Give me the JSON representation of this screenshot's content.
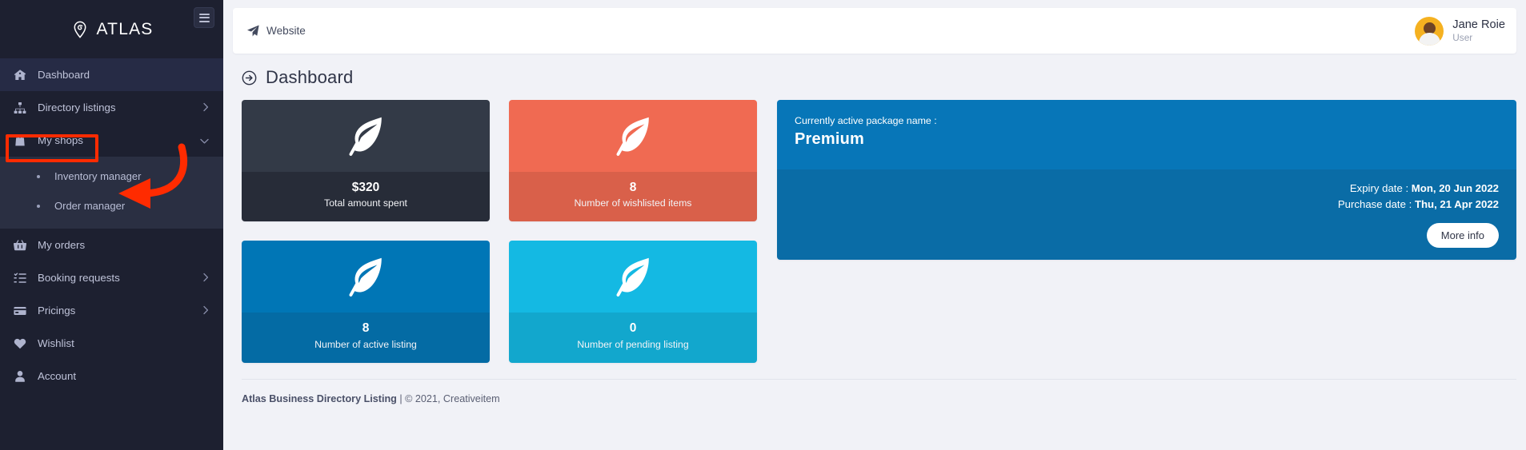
{
  "brand": {
    "name": "ATLAS",
    "icon": "location-pin-icon"
  },
  "sidebar": {
    "toggle_icon": "hamburger-icon",
    "items": [
      {
        "label": "Dashboard",
        "icon": "home-icon",
        "active": true,
        "chevron": ""
      },
      {
        "label": "Directory listings",
        "icon": "sitemap-icon",
        "active": false,
        "chevron": "›"
      },
      {
        "label": "My shops",
        "icon": "shop-bag-icon",
        "active": false,
        "chevron": "⌄"
      },
      {
        "label": "My orders",
        "icon": "basket-icon",
        "active": false,
        "chevron": ""
      },
      {
        "label": "Booking requests",
        "icon": "task-list-icon",
        "active": false,
        "chevron": "›"
      },
      {
        "label": "Pricings",
        "icon": "credit-card-icon",
        "active": false,
        "chevron": "›"
      },
      {
        "label": "Wishlist",
        "icon": "heart-icon",
        "active": false,
        "chevron": ""
      },
      {
        "label": "Account",
        "icon": "user-icon",
        "active": false,
        "chevron": ""
      }
    ],
    "submenu": [
      {
        "label": "Inventory manager"
      },
      {
        "label": "Order manager"
      }
    ]
  },
  "topbar": {
    "website_label": "Website",
    "website_icon": "paper-plane-icon",
    "user_name": "Jane Roie",
    "user_role": "User"
  },
  "page": {
    "title": "Dashboard",
    "title_icon": "arrow-circle-right-icon"
  },
  "stats": [
    {
      "value": "$320",
      "label": "Total amount spent",
      "icon": "leaf-icon",
      "top_color": "#333a47",
      "bottom_color": "#272c38"
    },
    {
      "value": "8",
      "label": "Number of wishlisted items",
      "icon": "leaf-icon",
      "top_color": "#f06a52",
      "bottom_color": "#d9604a"
    },
    {
      "value": "8",
      "label": "Number of active listing",
      "icon": "leaf-icon",
      "top_color": "#0076b6",
      "bottom_color": "#046ba4"
    },
    {
      "value": "0",
      "label": "Number of pending listing",
      "icon": "leaf-icon",
      "top_color": "#14b9e3",
      "bottom_color": "#12a7cd"
    }
  ],
  "package": {
    "active_label": "Currently active package name :",
    "name": "Premium",
    "expiry_label": "Expiry date : ",
    "expiry_value": "Mon, 20 Jun 2022",
    "purchase_label": "Purchase date : ",
    "purchase_value": "Thu, 21 Apr 2022",
    "more_info_label": "More info"
  },
  "footer": {
    "site_name": "Atlas Business Directory Listing",
    "copyright": " | © 2021, Creativeitem"
  },
  "annotations": {
    "highlight_target": "My shops",
    "arrow_target": "Order manager",
    "color": "#ff2b00"
  }
}
